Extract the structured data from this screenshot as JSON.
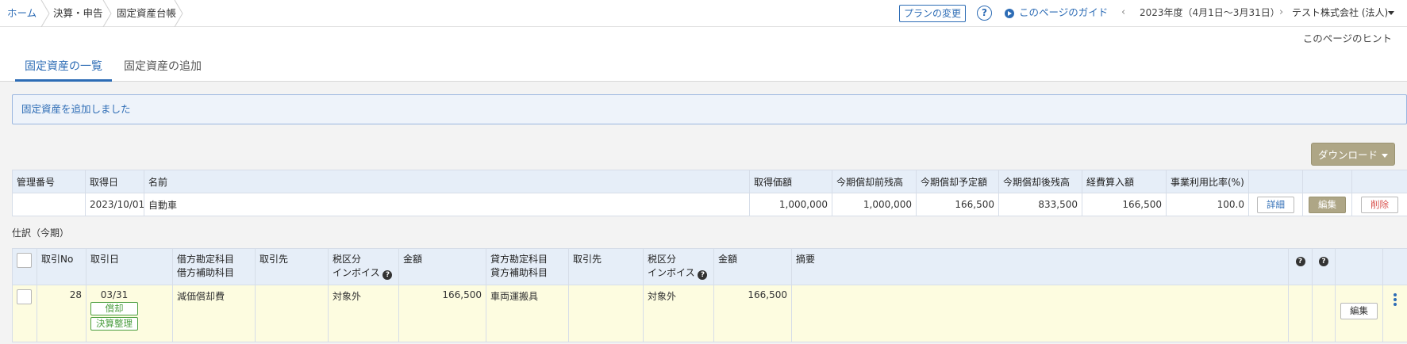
{
  "breadcrumb": {
    "home": "ホーム",
    "settlement": "決算・申告",
    "current": "固定資産台帳"
  },
  "header": {
    "plan_button": "プランの変更",
    "help_icon": "?",
    "guide_link": "このページのガイド",
    "fiscal_year": "2023年度（4月1日〜3月31日）",
    "company": "テスト株式会社 (法人)",
    "hint": "このページのヒント"
  },
  "tabs": {
    "list": "固定資産の一覧",
    "add": "固定資産の追加"
  },
  "notice": "固定資産を追加しました",
  "download_button": "ダウンロード",
  "asset_table": {
    "headers": {
      "id": "管理番号",
      "date": "取得日",
      "name": "名前",
      "acquire": "取得価額",
      "prior_balance": "今期償却前残高",
      "depreciation": "今期償却予定額",
      "post_balance": "今期償却後残高",
      "expense": "経費算入額",
      "ratio": "事業利用比率(%)"
    },
    "row": {
      "id": "",
      "date": "2023/10/01",
      "name": "自動車",
      "acquire": "1,000,000",
      "prior_balance": "1,000,000",
      "depreciation": "166,500",
      "post_balance": "833,500",
      "expense": "166,500",
      "ratio": "100.0",
      "detail_btn": "詳細",
      "edit_btn": "編集",
      "delete_btn": "削除"
    }
  },
  "journal_title": "仕訳（今期）",
  "journal_table": {
    "headers": {
      "no": "取引No",
      "date": "取引日",
      "debit_account": "借方勘定科目",
      "debit_sub": "借方補助科目",
      "debit_partner": "取引先",
      "debit_tax": "税区分",
      "debit_invoice": "インボイス",
      "debit_amount": "金額",
      "credit_account": "貸方勘定科目",
      "credit_sub": "貸方補助科目",
      "credit_partner": "取引先",
      "credit_tax": "税区分",
      "credit_invoice": "インボイス",
      "credit_amount": "金額",
      "memo": "摘要",
      "q": "?"
    },
    "row": {
      "no": "28",
      "date": "03/31",
      "tag1": "償却",
      "tag2": "決算整理",
      "debit_account": "減価償却費",
      "debit_partner": "",
      "debit_tax": "対象外",
      "debit_amount": "166,500",
      "credit_account": "車両運搬具",
      "credit_partner": "",
      "credit_tax": "対象外",
      "credit_amount": "166,500",
      "memo": "",
      "edit_btn": "編集"
    }
  },
  "colors": {
    "link": "#2d6cb5",
    "olive": "#aea686",
    "header_bg": "#e6eef8",
    "row_yellow": "#fdfce0",
    "red": "#d9534f",
    "green": "#4a9d3e"
  }
}
